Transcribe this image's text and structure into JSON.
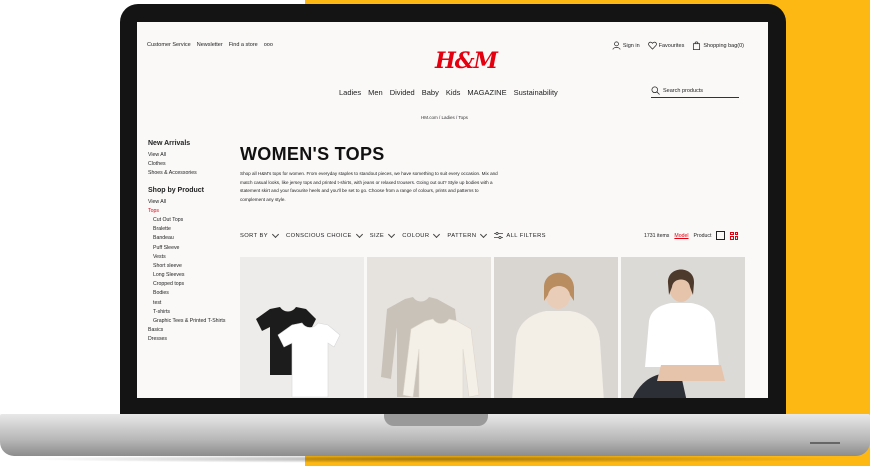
{
  "colors": {
    "accent": "#e50010",
    "yellow": "#fdb813",
    "bezel": "#141414",
    "page_bg": "#faf9f8"
  },
  "header": {
    "util_links": [
      "Customer Service",
      "Newsletter",
      "Find a store",
      "ooo"
    ],
    "logo": "H&M",
    "sign_in": "Sign in",
    "favourites": "Favourites",
    "bag": "Shopping bag(0)",
    "icons": {
      "sign_in": "user-icon",
      "favourites": "heart-icon",
      "bag": "bag-icon",
      "search": "search-icon"
    }
  },
  "nav": [
    "Ladies",
    "Men",
    "Divided",
    "Baby",
    "Kids",
    "MAGAZINE",
    "Sustainability"
  ],
  "search": {
    "placeholder": "Search products"
  },
  "breadcrumb": "HM.com / Ladies / Tops",
  "sidebar": {
    "new_arrivals_heading": "New Arrivals",
    "new_arrivals": [
      "View All",
      "Clothes",
      "Shoes & Accessories"
    ],
    "shop_by_product_heading": "Shop by Product",
    "view_all": "View All",
    "tops": "Tops",
    "tops_sub": [
      "Cut Out Tops",
      "Bralette",
      "Bandeau",
      "Puff Sleeve",
      "Vests",
      "Short sleeve",
      "Long Sleeves",
      "Cropped tops",
      "Bodies",
      "test",
      "T-shirts",
      "Graphic Tees & Printed T-Shirts"
    ],
    "more": [
      "Basics",
      "Dresses"
    ]
  },
  "page": {
    "title": "WOMEN'S TOPS",
    "desc_1": "Shop all H&M's tops for women. From everyday staples to standout pieces, we have something to suit every occasion. Mix and",
    "desc_2": "match casual looks, like jersey tops and printed t-shirts, with jeans or relaxed trousers. Going out out? Style up bodies with a",
    "desc_3": "statement skirt and your favourite heels and you'll be set to go. Choose from a range of colours, prints and patterns to",
    "desc_4": "complement any style."
  },
  "filters": {
    "sort_by": "SORT BY",
    "conscious": "CONSCIOUS CHOICE",
    "size": "SIZE",
    "colour": "COLOUR",
    "pattern": "PATTERN",
    "all_filters": "ALL FILTERS"
  },
  "results": {
    "count": "1731 items",
    "model": "Model",
    "product": "Product"
  }
}
